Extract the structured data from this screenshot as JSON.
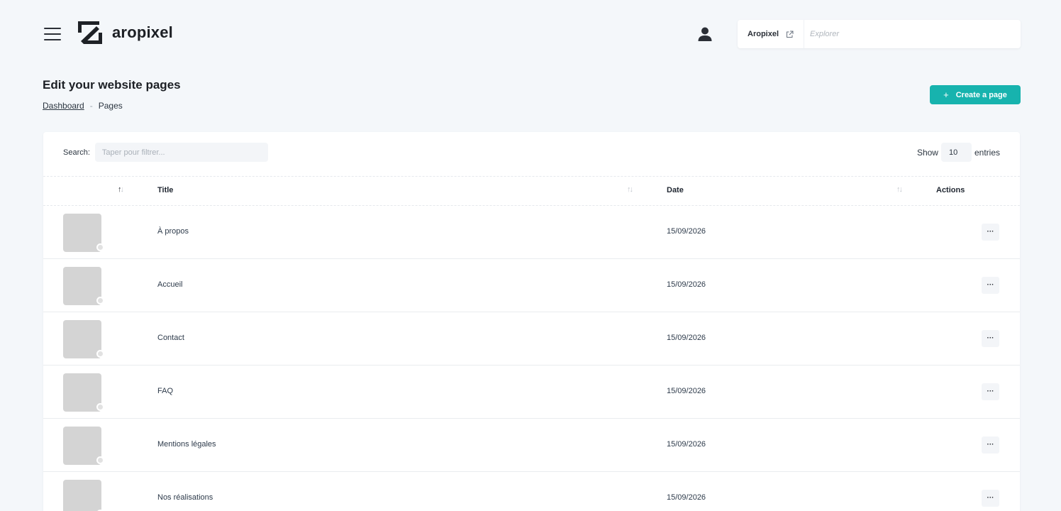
{
  "header": {
    "brand_name": "aropixel",
    "site": {
      "name": "Aropixel",
      "explore_placeholder": "Explorer"
    }
  },
  "page": {
    "title": "Edit your website pages",
    "breadcrumb": {
      "home": "Dashboard",
      "separator": "-",
      "current": "Pages"
    },
    "create_button": {
      "icon": "+",
      "label": "Create a page"
    }
  },
  "table": {
    "search_label": "Search:",
    "search_placeholder": "Taper pour filtrer...",
    "show_label": "Show",
    "entries_value": "10",
    "entries_label": "entries",
    "columns": {
      "title": "Title",
      "date": "Date",
      "actions": "Actions"
    },
    "sort_glyphs": {
      "up": "↑",
      "down": "↓"
    },
    "rows": [
      {
        "title": "À propos",
        "date": "15/09/2026",
        "action": "···"
      },
      {
        "title": "Accueil",
        "date": "15/09/2026",
        "action": "···"
      },
      {
        "title": "Contact",
        "date": "15/09/2026",
        "action": "···"
      },
      {
        "title": "FAQ",
        "date": "15/09/2026",
        "action": "···"
      },
      {
        "title": "Mentions légales",
        "date": "15/09/2026",
        "action": "···"
      },
      {
        "title": "Nos réalisations",
        "date": "15/09/2026",
        "action": "···"
      }
    ]
  },
  "colors": {
    "background": "#f4f7fa",
    "accent": "#17b3ae",
    "thumbnail": "#d4d4d4"
  },
  "icons": {
    "menu": "hamburger-menu-icon",
    "logo": "aropixel-logo-icon",
    "user": "user-icon",
    "external": "external-link-icon"
  }
}
